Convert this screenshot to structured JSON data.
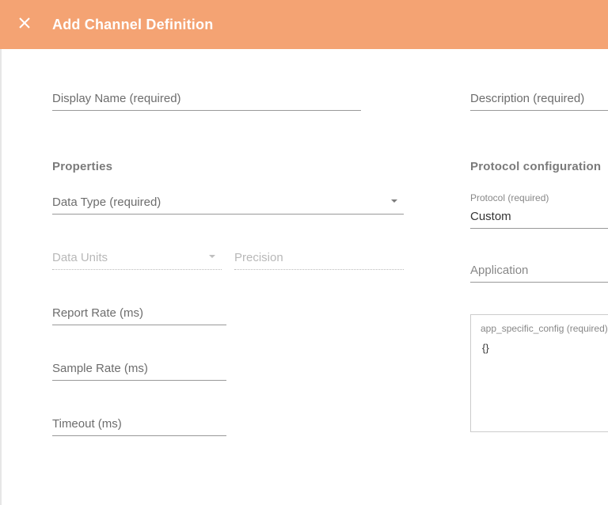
{
  "header": {
    "title": "Add Channel Definition"
  },
  "top": {
    "display_name_placeholder": "Display Name (required)",
    "description_placeholder": "Description (required)"
  },
  "sections": {
    "properties": "Properties",
    "protocol": "Protocol configuration"
  },
  "props": {
    "data_type_placeholder": "Data Type (required)",
    "data_units_placeholder": "Data Units",
    "precision_placeholder": "Precision",
    "report_rate_placeholder": "Report Rate (ms)",
    "sample_rate_placeholder": "Sample Rate (ms)",
    "timeout_placeholder": "Timeout (ms)"
  },
  "protocol": {
    "label": "Protocol (required)",
    "value": "Custom",
    "application_placeholder": "Application",
    "app_config_label": "app_specific_config (required)",
    "app_config_value": "{}"
  }
}
